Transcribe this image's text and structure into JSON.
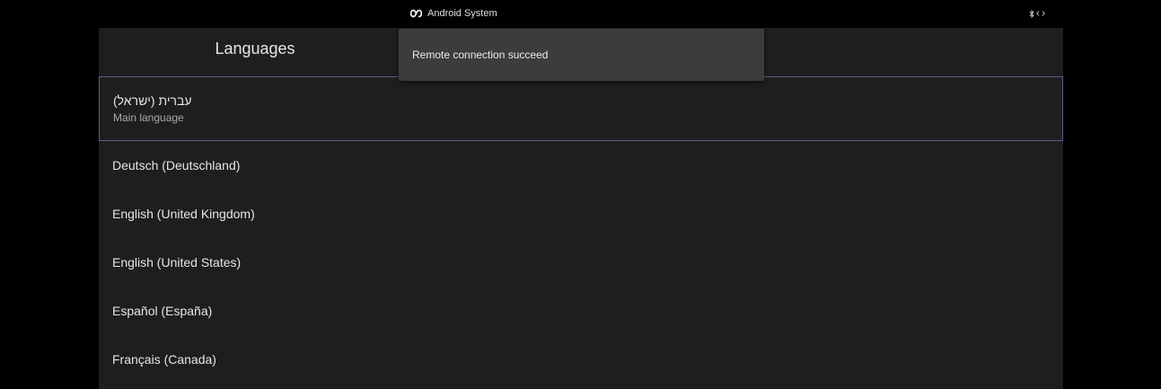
{
  "status_bar": {
    "app_name": "Android System",
    "app_icon": "infinity-logo-icon",
    "indicators": [
      "bluetooth-icon",
      "remote-link-icon"
    ]
  },
  "settings": {
    "title": "Languages",
    "languages": [
      {
        "label": "עברית (ישראל)",
        "sublabel": "Main language",
        "selected": true
      },
      {
        "label": "Deutsch (Deutschland)"
      },
      {
        "label": "English (United Kingdom)"
      },
      {
        "label": "English (United States)"
      },
      {
        "label": "Español (España)"
      },
      {
        "label": "Français (Canada)"
      }
    ]
  },
  "toast": {
    "message": "Remote connection succeed"
  },
  "colors": {
    "background": "#000000",
    "panel": "#1f1e1e",
    "toast": "#3d3c3c",
    "selection_border": "#5e5b8e"
  }
}
